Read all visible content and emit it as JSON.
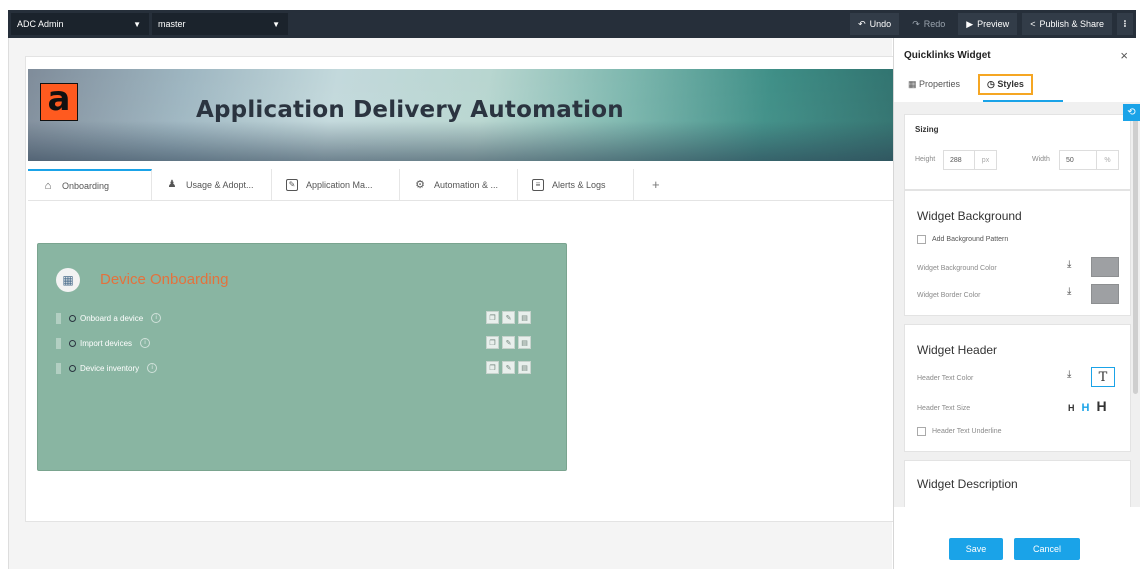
{
  "topbar": {
    "org_select": "ADC Admin",
    "branch_select": "master",
    "undo_label": "Undo",
    "redo_label": "Redo",
    "preview_label": "Preview",
    "publish_label": "Publish & Share",
    "more_label": "⁝"
  },
  "banner": {
    "logo_letter": "a",
    "title": "Application Delivery Automation",
    "logo_color": "#ff5a1f"
  },
  "tabs": [
    {
      "label": "Onboarding",
      "icon": "home-icon",
      "active": true
    },
    {
      "label": "Usage & Adopt...",
      "icon": "users-icon",
      "active": false
    },
    {
      "label": "Application Ma...",
      "icon": "edit-doc-icon",
      "active": false
    },
    {
      "label": "Automation & ...",
      "icon": "gear-icon",
      "active": false
    },
    {
      "label": "Alerts & Logs",
      "icon": "doc-icon",
      "active": false
    }
  ],
  "widget": {
    "title": "Device Onboarding",
    "background_color": "#89b5a2",
    "title_color": "#e3723d",
    "links": [
      {
        "label": "Onboard a device"
      },
      {
        "label": "Import devices"
      },
      {
        "label": "Device inventory"
      }
    ]
  },
  "panel": {
    "title": "Quicklinks Widget",
    "tab_properties": "Properties",
    "tab_styles": "Styles",
    "sizing": {
      "label": "Sizing",
      "height_label": "Height",
      "height_value": "288",
      "height_unit": "px",
      "width_label": "Width",
      "width_value": "50",
      "width_unit": "%"
    },
    "background": {
      "title": "Widget Background",
      "pattern_label": "Add Background Pattern",
      "bg_color_label": "Widget Background Color",
      "border_color_label": "Widget Border Color",
      "swatch_color": "#9ea0a3"
    },
    "header": {
      "title": "Widget Header",
      "text_color_label": "Header Text Color",
      "text_color_glyph": "T",
      "text_size_label": "Header Text Size",
      "size_small": "H",
      "size_medium": "H",
      "size_large": "H",
      "underline_label": "Header Text Underline"
    },
    "description": {
      "title": "Widget Description"
    },
    "save_label": "Save",
    "cancel_label": "Cancel",
    "accent_color": "#1aa3e8",
    "highlight_color": "#f5a623"
  }
}
